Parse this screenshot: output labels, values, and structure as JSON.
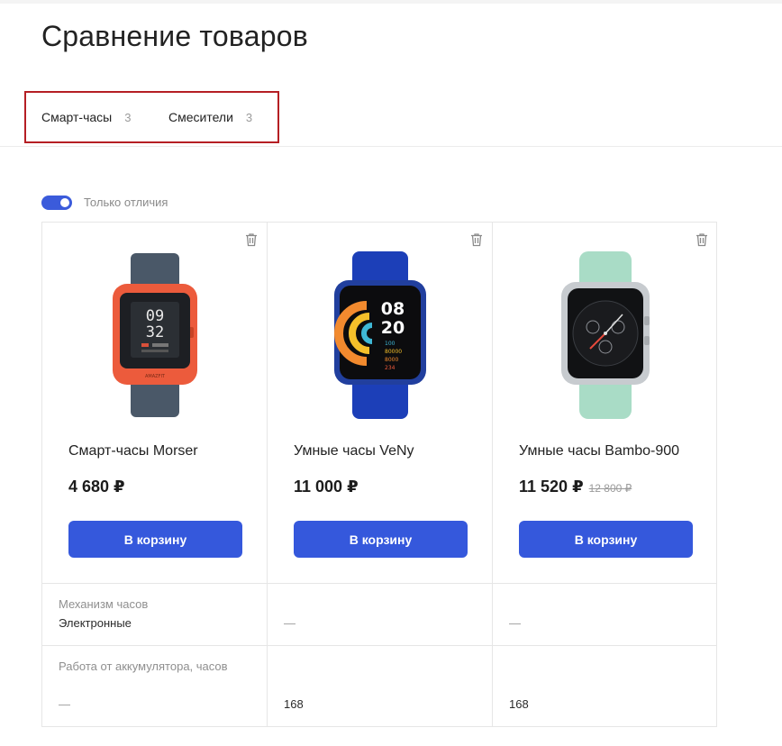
{
  "page": {
    "title": "Сравнение товаров"
  },
  "tabs": [
    {
      "label": "Смарт-часы",
      "count": "3"
    },
    {
      "label": "Смесители",
      "count": "3"
    }
  ],
  "filter": {
    "label": "Только отличия",
    "enabled": true
  },
  "products": [
    {
      "name": "Смарт-часы Morser",
      "price": "4 680 ₽",
      "old_price": "",
      "button": "В корзину",
      "image_icon": "smartwatch-orange-icon"
    },
    {
      "name": "Умные часы VeNy",
      "price": "11 000 ₽",
      "old_price": "",
      "button": "В корзину",
      "image_icon": "smartwatch-blue-icon"
    },
    {
      "name": "Умные часы Bambo-900",
      "price": "11 520 ₽",
      "old_price": "12 800 ₽",
      "button": "В корзину",
      "image_icon": "smartwatch-mint-icon"
    }
  ],
  "specs": [
    {
      "label": "Механизм часов",
      "values": [
        "Электронные",
        "—",
        "—"
      ]
    },
    {
      "label": "Работа от аккумулятора, часов",
      "values": [
        "—",
        "168",
        "168"
      ]
    }
  ],
  "watch_faces": {
    "p1": {
      "time_hours": "09",
      "time_minutes": "32"
    },
    "p2": {
      "time_hours": "08",
      "time_minutes": "20",
      "stat1": "100",
      "stat2": "80000",
      "stat3": "8000",
      "stat4": "234"
    }
  },
  "colors": {
    "accent": "#3558dc",
    "highlight_border": "#b51f24",
    "toggle": "#3b5bdb"
  }
}
